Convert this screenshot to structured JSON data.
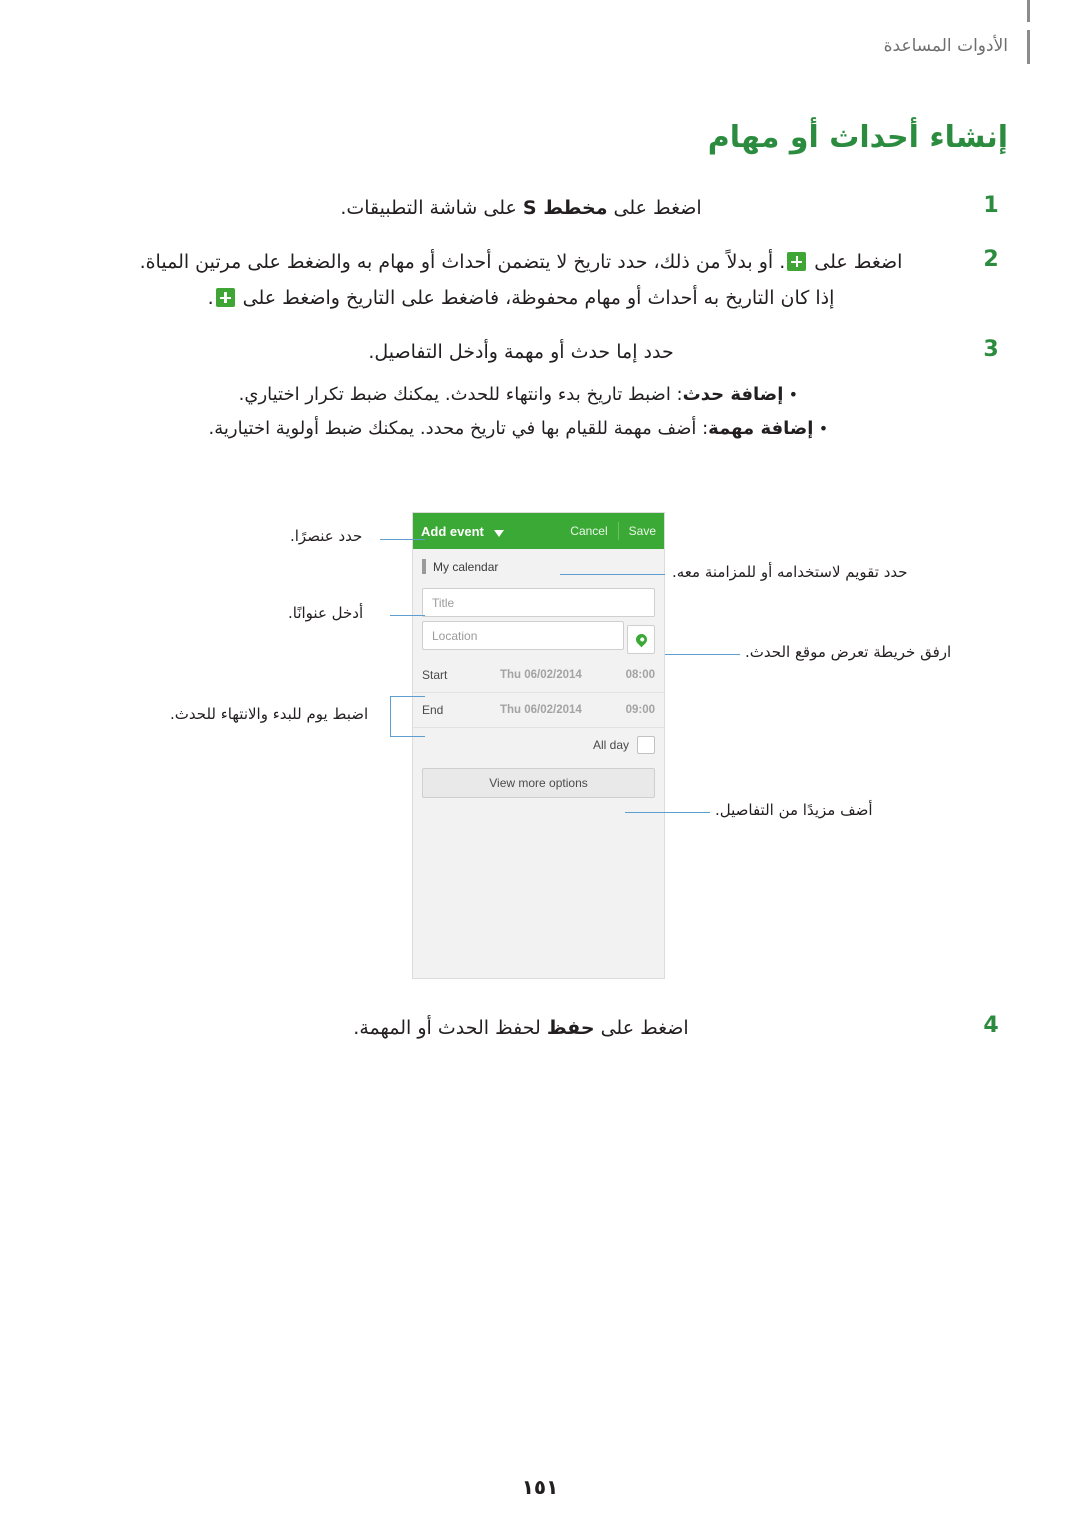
{
  "header": {
    "section_label": "الأدوات المساعدة"
  },
  "title": "إنشاء أحداث أو مهام",
  "steps": [
    {
      "num": "1",
      "text_parts": [
        {
          "t": "اضغط على "
        },
        {
          "t": "مخطط S",
          "bold": true
        },
        {
          "t": " على شاشة التطبيقات."
        }
      ]
    },
    {
      "num": "2",
      "lines": [
        {
          "parts": [
            {
              "t": "اضغط على "
            },
            {
              "icon": "plus-icon"
            },
            {
              "t": ". أو بدلاً من ذلك، حدد تاريخ لا يتضمن أحداث أو مهام به والضغط على مرتين المياة."
            }
          ]
        },
        {
          "parts": [
            {
              "t": "إذا كان التاريخ به أحداث أو مهام محفوظة، فاضغط على التاريخ واضغط على "
            },
            {
              "icon": "plus-icon"
            },
            {
              "t": "."
            }
          ]
        }
      ]
    },
    {
      "num": "3",
      "text_parts": [
        {
          "t": "حدد إما حدث أو مهمة وأدخل التفاصيل."
        }
      ],
      "bullets": [
        {
          "parts": [
            {
              "t": "إضافة حدث",
              "bold": true
            },
            {
              "t": ": اضبط تاريخ بدء وانتهاء للحدث. يمكنك ضبط تكرار اختياري."
            }
          ]
        },
        {
          "parts": [
            {
              "t": "إضافة مهمة",
              "bold": true
            },
            {
              "t": ": أضف مهمة للقيام بها في تاريخ محدد. يمكنك ضبط أولوية اختيارية."
            }
          ]
        }
      ]
    }
  ],
  "last_step": {
    "num": "4",
    "parts": [
      {
        "t": "اضغط على "
      },
      {
        "t": "حفظ",
        "bold": true
      },
      {
        "t": " لحفظ الحدث أو المهمة."
      }
    ]
  },
  "phone": {
    "topbar": {
      "add_event": "Add event",
      "cancel": "Cancel",
      "save": "Save"
    },
    "calendar_name": "My calendar",
    "title_placeholder": "Title",
    "location_placeholder": "Location",
    "start": {
      "label": "Start",
      "date": "Thu 06/02/2014",
      "time": "08:00"
    },
    "end": {
      "label": "End",
      "date": "Thu 06/02/2014",
      "time": "09:00"
    },
    "all_day": "All day",
    "view_more": "View more options"
  },
  "callouts": {
    "element_type": "حدد عنصرًا.",
    "calendar_use": "حدد تقويم لاستخدامه أو للمزامنة معه.",
    "enter_title": "أدخل عنوانًا.",
    "attach_map": "ارفق خريطة تعرض موقع الحدث.",
    "set_dates": "اضبط يوم للبدء والانتهاء للحدث.",
    "more_details": "أضف مزيدًا من التفاصيل."
  },
  "page_number": "١٥١"
}
